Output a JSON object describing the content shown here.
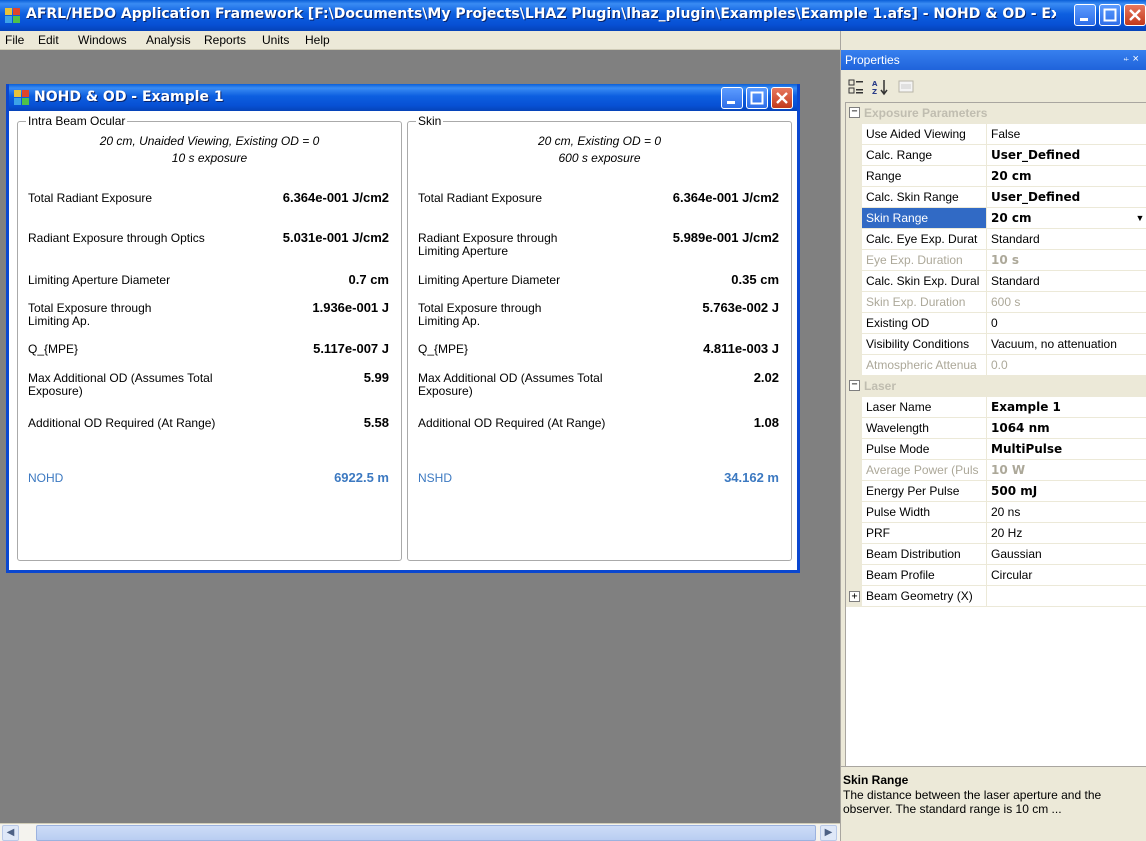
{
  "app": {
    "title": "AFRL/HEDO Application Framework [F:\\Documents\\My Projects\\LHAZ Plugin\\lhaz_plugin\\Examples\\Example 1.afs] - NOHD & OD - Ex..."
  },
  "menu": [
    "File",
    "Edit",
    "Windows",
    "Analysis",
    "Reports",
    "Units",
    "Help"
  ],
  "child": {
    "title": "NOHD & OD - Example 1",
    "ocular": {
      "legend": "Intra Beam Ocular",
      "sub1": "20 cm, Unaided Viewing, Existing OD = 0",
      "sub2": "10 s exposure",
      "rows": [
        {
          "label": "Total Radiant Exposure",
          "value": "6.364e-001 J/cm2"
        },
        {
          "label": "Radiant Exposure through Optics",
          "value": "5.031e-001 J/cm2"
        },
        {
          "label": "Limiting Aperture Diameter",
          "value": "0.7 cm"
        },
        {
          "label": "Total Exposure through Limiting Ap.",
          "value": "1.936e-001 J"
        },
        {
          "label": "Q_{MPE}",
          "value": "5.117e-007 J"
        },
        {
          "label": "Max Additional OD (Assumes Total Exposure)",
          "value": "5.99"
        },
        {
          "label": "Additional OD Required (At Range)",
          "value": "5.58"
        }
      ],
      "result_label": "NOHD",
      "result_value": "6922.5 m"
    },
    "skin": {
      "legend": "Skin",
      "sub1": "20 cm, Existing OD = 0",
      "sub2": "600 s exposure",
      "rows": [
        {
          "label": "Total Radiant Exposure",
          "value": "6.364e-001 J/cm2"
        },
        {
          "label": "Radiant Exposure through Limiting Aperture",
          "value": "5.989e-001 J/cm2"
        },
        {
          "label": "Limiting Aperture Diameter",
          "value": "0.35 cm"
        },
        {
          "label": "Total Exposure through Limiting Ap.",
          "value": "5.763e-002 J"
        },
        {
          "label": "Q_{MPE}",
          "value": "4.811e-003 J"
        },
        {
          "label": "Max Additional OD (Assumes Total Exposure)",
          "value": "2.02"
        },
        {
          "label": "Additional OD Required (At Range)",
          "value": "1.08"
        }
      ],
      "result_label": "NSHD",
      "result_value": "34.162 m"
    }
  },
  "properties": {
    "panel_title": "Properties",
    "pin_glyph": "⍅ ×",
    "categories": {
      "exposure": "Exposure Parameters",
      "laser": "Laser"
    },
    "exposure_rows": [
      {
        "name": "Use Aided Viewing",
        "value": "False",
        "bold": false,
        "disabled": false
      },
      {
        "name": "Calc. Range",
        "value": "User_Defined",
        "bold": true,
        "disabled": false
      },
      {
        "name": "Range",
        "value": "20 cm",
        "bold": true,
        "disabled": false
      },
      {
        "name": "Calc. Skin Range",
        "value": "User_Defined",
        "bold": true,
        "disabled": false
      },
      {
        "name": "Skin Range",
        "value": "20 cm",
        "bold": true,
        "disabled": false,
        "selected": true
      },
      {
        "name": "Calc. Eye Exp. Durat",
        "value": "Standard",
        "bold": false,
        "disabled": false
      },
      {
        "name": "Eye Exp. Duration",
        "value": "10 s",
        "bold": true,
        "disabled": true
      },
      {
        "name": "Calc. Skin Exp. Dural",
        "value": "Standard",
        "bold": false,
        "disabled": false
      },
      {
        "name": "Skin Exp. Duration",
        "value": "600 s",
        "bold": false,
        "disabled": true
      },
      {
        "name": "Existing OD",
        "value": "0",
        "bold": false,
        "disabled": false
      },
      {
        "name": "Visibility Conditions",
        "value": "Vacuum, no attenuation",
        "bold": false,
        "disabled": false
      },
      {
        "name": "Atmospheric Attenua",
        "value": "0.0",
        "bold": false,
        "disabled": true
      }
    ],
    "laser_rows": [
      {
        "name": "Laser Name",
        "value": "Example 1",
        "bold": true,
        "disabled": false
      },
      {
        "name": "Wavelength",
        "value": "1064 nm",
        "bold": true,
        "disabled": false
      },
      {
        "name": "Pulse Mode",
        "value": "MultiPulse",
        "bold": true,
        "disabled": false
      },
      {
        "name": "Average Power (Puls",
        "value": "10 W",
        "bold": true,
        "disabled": true
      },
      {
        "name": "Energy Per Pulse",
        "value": "500 mJ",
        "bold": true,
        "disabled": false
      },
      {
        "name": "Pulse Width",
        "value": "20 ns",
        "bold": false,
        "disabled": false
      },
      {
        "name": "PRF",
        "value": "20 Hz",
        "bold": false,
        "disabled": false
      },
      {
        "name": "Beam Distribution",
        "value": "Gaussian",
        "bold": false,
        "disabled": false
      },
      {
        "name": "Beam Profile",
        "value": "Circular",
        "bold": false,
        "disabled": false
      },
      {
        "name": "Beam Geometry (X)",
        "value": "",
        "bold": false,
        "disabled": false,
        "expandable": true
      }
    ],
    "description": {
      "title": "Skin Range",
      "text": "The distance between the laser aperture and the observer.  The standard range is 10 cm ..."
    }
  },
  "colors": {
    "titlebar": "#0d5fe0",
    "selected_row": "#316ac5",
    "result_text": "#3c79c1",
    "mdi_background": "#808080"
  }
}
